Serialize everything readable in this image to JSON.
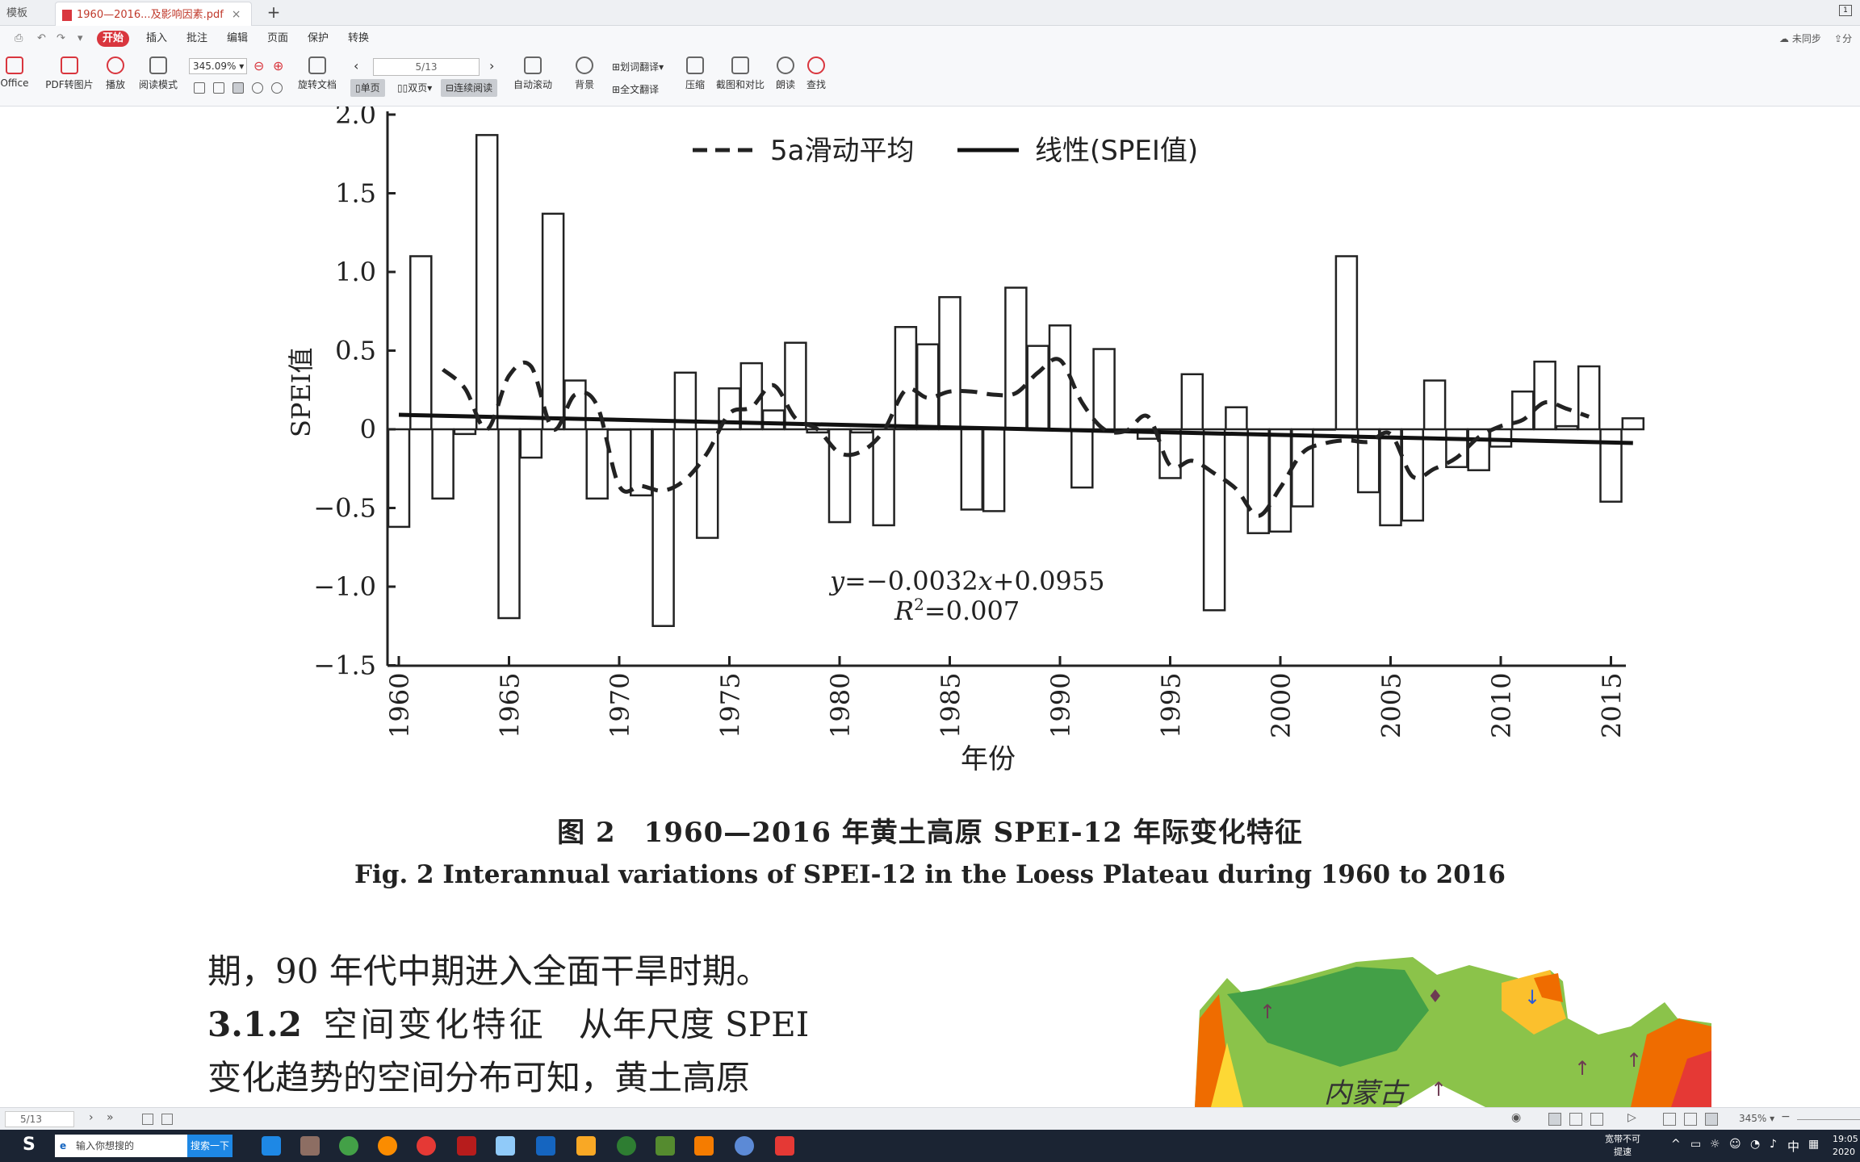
{
  "tabs": [
    {
      "label": "模板"
    },
    {
      "label": "1960—2016...及影响因素.pdf",
      "active": true
    }
  ],
  "menu": {
    "items": [
      "开始",
      "插入",
      "批注",
      "编辑",
      "页面",
      "保护",
      "转换"
    ],
    "sync": "未同步",
    "share": "分"
  },
  "toolbar": {
    "office": "Office",
    "pdf_to_image": "PDF转图片",
    "play": "播放",
    "read_mode": "阅读模式",
    "rotate_doc": "旋转文档",
    "zoom": "345.09%",
    "page_indicator": "5/13",
    "single": "单页",
    "double": "双页",
    "continuous": "连续阅读",
    "auto_scroll": "自动滚动",
    "background": "背景",
    "word_translate": "划词翻译",
    "full_translate": "全文翻译",
    "compress": "压缩",
    "screenshot_compare": "截图和对比",
    "read_aloud": "朗读",
    "find": "查找"
  },
  "chart_data": {
    "type": "bar+line",
    "legend": [
      "5a滑动平均",
      "线性(SPEI值)"
    ],
    "ylabel": "SPEI值",
    "xlabel": "年份",
    "ylim": [
      -1.5,
      2.0
    ],
    "yticks": [
      "2.0",
      "1.5",
      "1.0",
      "0.5",
      "0",
      "−0.5",
      "−1.0",
      "−1.5"
    ],
    "xticks": [
      "1960",
      "1965",
      "1970",
      "1975",
      "1980",
      "1985",
      "1990",
      "1995",
      "2000",
      "2005",
      "2010",
      "2015"
    ],
    "years": [
      1960,
      1961,
      1962,
      1963,
      1964,
      1965,
      1966,
      1967,
      1968,
      1969,
      1970,
      1971,
      1972,
      1973,
      1974,
      1975,
      1976,
      1977,
      1978,
      1979,
      1980,
      1981,
      1982,
      1983,
      1984,
      1985,
      1986,
      1987,
      1988,
      1989,
      1990,
      1991,
      1992,
      1993,
      1994,
      1995,
      1996,
      1997,
      1998,
      1999,
      2000,
      2001,
      2002,
      2003,
      2004,
      2005,
      2006,
      2007,
      2008,
      2009,
      2010,
      2011,
      2012,
      2013,
      2014,
      2015,
      2016
    ],
    "values": [
      -0.62,
      1.1,
      -0.44,
      -0.03,
      1.87,
      -1.2,
      -0.18,
      1.37,
      0.31,
      -0.44,
      0.0,
      -0.42,
      -1.25,
      0.36,
      -0.69,
      0.26,
      0.42,
      0.12,
      0.55,
      -0.02,
      -0.59,
      -0.02,
      -0.61,
      0.65,
      0.54,
      0.84,
      -0.51,
      -0.52,
      0.9,
      0.53,
      0.66,
      -0.37,
      0.51,
      0.0,
      -0.06,
      -0.31,
      0.35,
      -1.15,
      0.14,
      -0.66,
      -0.65,
      -0.49,
      0.0,
      1.1,
      -0.4,
      -0.61,
      -0.58,
      0.31,
      -0.24,
      -0.26,
      -0.11,
      0.24,
      0.43,
      0.02,
      0.4,
      -0.46,
      0.07
    ],
    "moving_avg": {
      "x": [
        1962,
        1963,
        1964,
        1965,
        1966,
        1967,
        1968,
        1969,
        1970,
        1971,
        1972,
        1973,
        1974,
        1975,
        1976,
        1977,
        1978,
        1979,
        1980,
        1981,
        1982,
        1983,
        1984,
        1985,
        1986,
        1987,
        1988,
        1989,
        1990,
        1991,
        1992,
        1993,
        1994,
        1995,
        1996,
        1997,
        1998,
        1999,
        2000,
        2001,
        2002,
        2003,
        2004,
        2005,
        2006,
        2007,
        2008,
        2009,
        2010,
        2011,
        2012,
        2013,
        2014
      ],
      "y": [
        0.38,
        0.26,
        0.0,
        0.34,
        0.4,
        0.0,
        0.22,
        0.15,
        -0.36,
        -0.36,
        -0.39,
        -0.32,
        -0.15,
        0.1,
        0.14,
        0.28,
        0.07,
        0.0,
        -0.15,
        -0.14,
        -0.01,
        0.25,
        0.2,
        0.24,
        0.24,
        0.22,
        0.23,
        0.36,
        0.44,
        0.17,
        0.0,
        -0.01,
        0.08,
        -0.23,
        -0.2,
        -0.28,
        -0.38,
        -0.55,
        -0.37,
        -0.15,
        -0.09,
        -0.07,
        -0.08,
        -0.03,
        -0.3,
        -0.25,
        -0.18,
        -0.05,
        0.02,
        0.06,
        0.17,
        0.13,
        0.08
      ]
    },
    "trend": {
      "slope": -0.0032,
      "intercept": 0.0955,
      "x_start": 1960,
      "x_end": 2016
    },
    "equation": {
      "prefix": "y",
      "eq": "=−0.0032",
      "var": "x",
      "rest": "+0.0955",
      "r2_label": "R",
      "r2_sup": "2",
      "r2_value": "=0.007"
    }
  },
  "caption": {
    "cn": "图 2　1960—2016 年黄土高原 SPEI-12 年际变化特征",
    "en": "Fig. 2   Interannual variations of SPEI-12 in the Loess Plateau during 1960 to 2016"
  },
  "body": {
    "line1": "期，90 年代中期进入全面干旱时期。",
    "line2_num": "3.1.2",
    "line2_title": "空间变化特征",
    "line2_rest": "从年尺度 SPEI",
    "line3": "变化趋势的空间分布可知，黄土高原"
  },
  "map": {
    "label": "内蒙古"
  },
  "status": {
    "page": "5/13",
    "zoom": "345%"
  },
  "taskbar": {
    "search_placeholder": "输入你想搜的",
    "search_button": "搜索一下",
    "net_status_1": "宽带不可",
    "net_status_2": "提速",
    "ime": "中",
    "time": "19:05",
    "date": "2020"
  }
}
